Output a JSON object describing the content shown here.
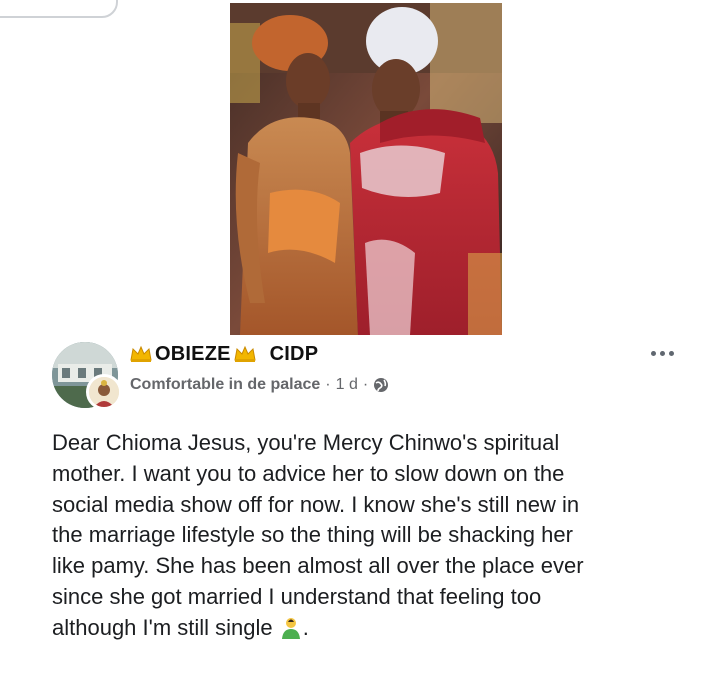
{
  "post": {
    "author": {
      "name_part1": "OBIEZE",
      "name_part2": "CIDP",
      "name_icon": "crown-emoji"
    },
    "meta": {
      "page": "Comfortable in de palace",
      "separator": "·",
      "time": "1 d",
      "privacy_icon": "globe-icon"
    },
    "more_icon": "more-options-icon",
    "text": "Dear Chioma Jesus, you're Mercy Chinwo's spiritual\nmother. I want you to advice her to slow down on the\nsocial media show off for now. I know she's still new in\nthe marriage lifestyle so the thing will be shacking her\nlike pamy. She has been almost all over the place ever\nsince she got married I understand that feeling too\nalthough I'm still single",
    "text_end": ".",
    "trailing_emoji": "person-emoji"
  },
  "colors": {
    "name": "#111111",
    "meta": "#65676b",
    "body": "#1c1e21"
  }
}
